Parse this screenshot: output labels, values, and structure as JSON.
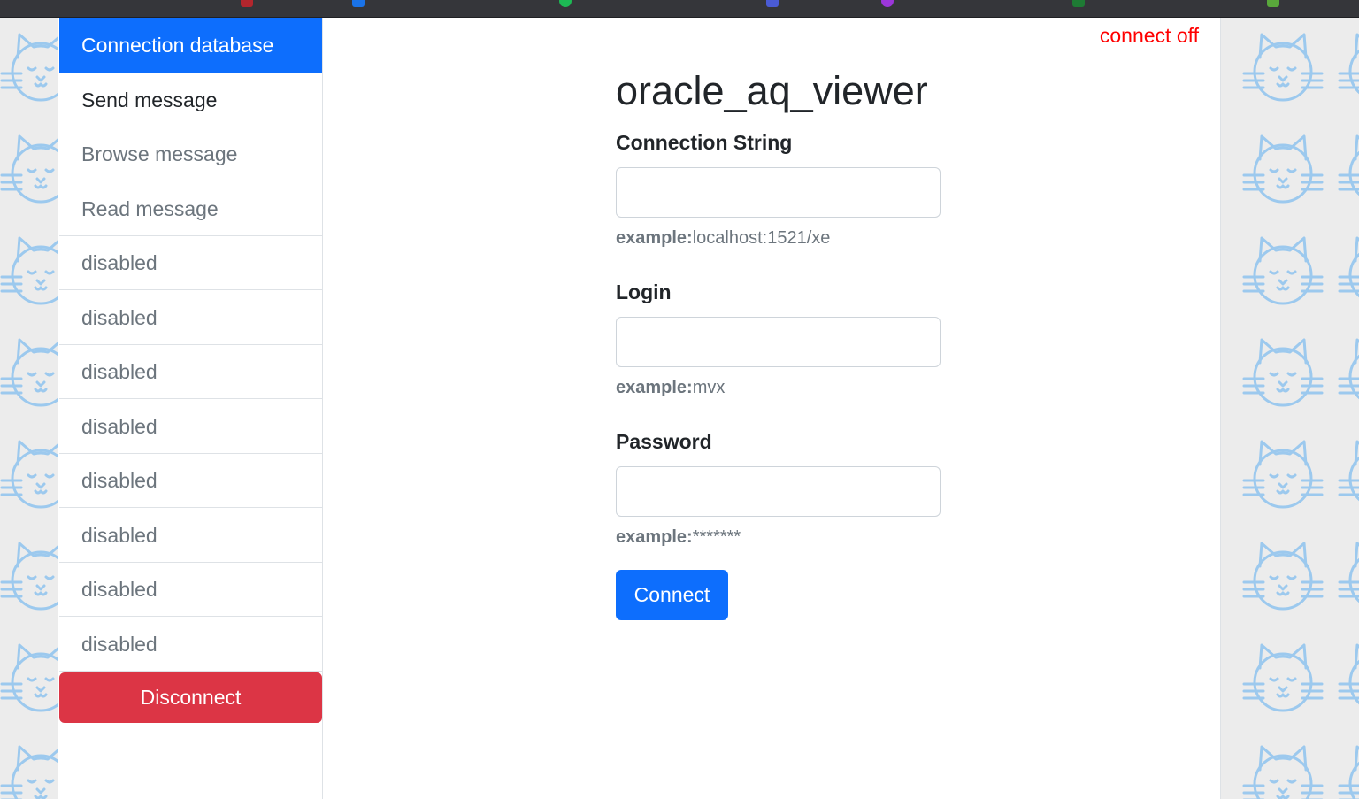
{
  "status": {
    "text": "connect off",
    "color": "#ff0000"
  },
  "sidebar": {
    "items": [
      {
        "label": "Connection database",
        "state": "active"
      },
      {
        "label": "Send message",
        "state": "normal"
      },
      {
        "label": "Browse message",
        "state": "muted"
      },
      {
        "label": "Read message",
        "state": "muted"
      },
      {
        "label": "disabled",
        "state": "muted"
      },
      {
        "label": "disabled",
        "state": "muted"
      },
      {
        "label": "disabled",
        "state": "muted"
      },
      {
        "label": "disabled",
        "state": "muted"
      },
      {
        "label": "disabled",
        "state": "muted"
      },
      {
        "label": "disabled",
        "state": "muted"
      },
      {
        "label": "disabled",
        "state": "muted"
      },
      {
        "label": "disabled",
        "state": "muted"
      }
    ],
    "disconnect_label": "Disconnect"
  },
  "form": {
    "title": "oracle_aq_viewer",
    "fields": [
      {
        "label": "Connection String",
        "value": "",
        "hint_prefix": "example:",
        "hint_value": "localhost:1521/xe"
      },
      {
        "label": "Login",
        "value": "",
        "hint_prefix": "example:",
        "hint_value": "mvx"
      },
      {
        "label": "Password",
        "value": "",
        "hint_prefix": "example:",
        "hint_value": "*******"
      }
    ],
    "connect_label": "Connect"
  },
  "colors": {
    "primary": "#0d6efd",
    "danger": "#dc3545",
    "muted_text": "#6c757d",
    "pattern_cat": "#9cc9ee"
  },
  "icons": {
    "background_pattern": "cat-face-icon"
  }
}
